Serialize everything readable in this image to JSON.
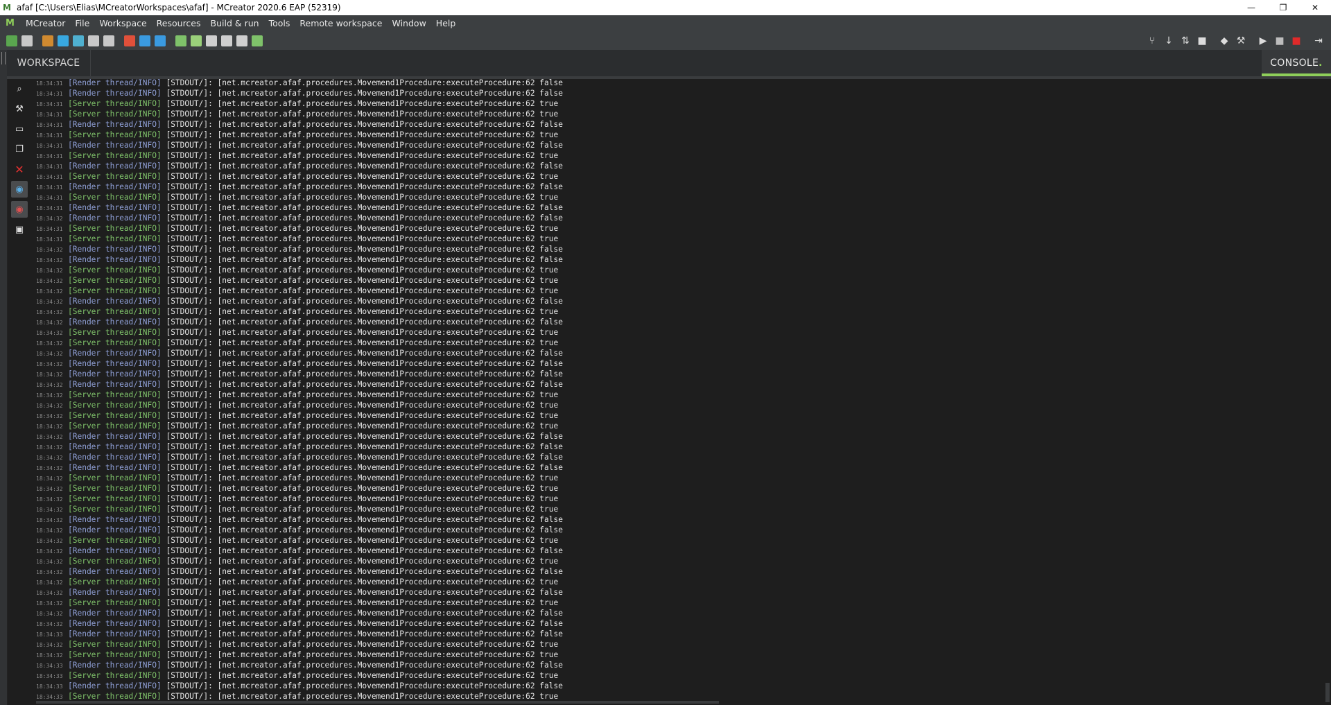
{
  "window": {
    "title": "afaf [C:\\Users\\Elias\\MCreatorWorkspaces\\afaf]  - MCreator 2020.6 EAP (52319)",
    "minimize": "—",
    "maximize": "❐",
    "close": "✕"
  },
  "menubar": {
    "items": [
      "MCreator",
      "File",
      "Workspace",
      "Resources",
      "Build & run",
      "Tools",
      "Remote workspace",
      "Window",
      "Help"
    ]
  },
  "toolbar": {
    "left_icon_colors": [
      "#5aa64f",
      "#c8c8c8",
      "#d08a30",
      "#38a8e0",
      "#4fb0d0",
      "#c8c8c8",
      "#c8c8c8",
      "#e0503a",
      "#3a9ae0",
      "#3a9ae0",
      "#7fc26a",
      "#9ad07a",
      "#cfcfcf",
      "#cfcfcf",
      "#cfcfcf",
      "#7fc26a"
    ],
    "right_icons": [
      "git-branch-icon",
      "pull-icon",
      "push-icon",
      "folder-icon",
      "eraser-icon",
      "hammer-icon",
      "run-icon",
      "stop-gray-icon",
      "stop-red-icon",
      "export-icon"
    ]
  },
  "tabs": {
    "workspace": "WORKSPACE",
    "console": "CONSOLE",
    "console_dot": "."
  },
  "console_tools": [
    {
      "name": "search-icon",
      "glyph": "⌕"
    },
    {
      "name": "build-icon",
      "glyph": "⚒"
    },
    {
      "name": "terminal-icon",
      "glyph": "▭"
    },
    {
      "name": "copy-icon",
      "glyph": "❐"
    },
    {
      "name": "clear-icon",
      "glyph": "✕"
    },
    {
      "name": "eye-blue-icon",
      "glyph": "◉"
    },
    {
      "name": "eye-red-icon",
      "glyph": "◉"
    },
    {
      "name": "lock-icon",
      "glyph": "🔒"
    }
  ],
  "console": {
    "lines": [
      {
        "time": "18:34:31",
        "thread": "[Render thread/INFO]",
        "text": " [STDOUT/]: [net.mcreator.afaf.procedures.Movemend1Procedure:executeProcedure:62 false"
      },
      {
        "time": "18:34:31",
        "thread": "[Render thread/INFO]",
        "text": " [STDOUT/]: [net.mcreator.afaf.procedures.Movemend1Procedure:executeProcedure:62 false"
      },
      {
        "time": "18:34:31",
        "thread": "[Server thread/INFO]",
        "text": " [STDOUT/]: [net.mcreator.afaf.procedures.Movemend1Procedure:executeProcedure:62 true"
      },
      {
        "time": "18:34:31",
        "thread": "[Server thread/INFO]",
        "text": " [STDOUT/]: [net.mcreator.afaf.procedures.Movemend1Procedure:executeProcedure:62 true"
      },
      {
        "time": "18:34:31",
        "thread": "[Render thread/INFO]",
        "text": " [STDOUT/]: [net.mcreator.afaf.procedures.Movemend1Procedure:executeProcedure:62 false"
      },
      {
        "time": "18:34:31",
        "thread": "[Server thread/INFO]",
        "text": " [STDOUT/]: [net.mcreator.afaf.procedures.Movemend1Procedure:executeProcedure:62 true"
      },
      {
        "time": "18:34:31",
        "thread": "[Render thread/INFO]",
        "text": " [STDOUT/]: [net.mcreator.afaf.procedures.Movemend1Procedure:executeProcedure:62 false"
      },
      {
        "time": "18:34:31",
        "thread": "[Server thread/INFO]",
        "text": " [STDOUT/]: [net.mcreator.afaf.procedures.Movemend1Procedure:executeProcedure:62 true"
      },
      {
        "time": "18:34:31",
        "thread": "[Render thread/INFO]",
        "text": " [STDOUT/]: [net.mcreator.afaf.procedures.Movemend1Procedure:executeProcedure:62 false"
      },
      {
        "time": "18:34:31",
        "thread": "[Server thread/INFO]",
        "text": " [STDOUT/]: [net.mcreator.afaf.procedures.Movemend1Procedure:executeProcedure:62 true"
      },
      {
        "time": "18:34:31",
        "thread": "[Render thread/INFO]",
        "text": " [STDOUT/]: [net.mcreator.afaf.procedures.Movemend1Procedure:executeProcedure:62 false"
      },
      {
        "time": "18:34:31",
        "thread": "[Server thread/INFO]",
        "text": " [STDOUT/]: [net.mcreator.afaf.procedures.Movemend1Procedure:executeProcedure:62 true"
      },
      {
        "time": "18:34:31",
        "thread": "[Render thread/INFO]",
        "text": " [STDOUT/]: [net.mcreator.afaf.procedures.Movemend1Procedure:executeProcedure:62 false"
      },
      {
        "time": "18:34:32",
        "thread": "[Render thread/INFO]",
        "text": " [STDOUT/]: [net.mcreator.afaf.procedures.Movemend1Procedure:executeProcedure:62 false"
      },
      {
        "time": "18:34:31",
        "thread": "[Server thread/INFO]",
        "text": " [STDOUT/]: [net.mcreator.afaf.procedures.Movemend1Procedure:executeProcedure:62 true"
      },
      {
        "time": "18:34:31",
        "thread": "[Server thread/INFO]",
        "text": " [STDOUT/]: [net.mcreator.afaf.procedures.Movemend1Procedure:executeProcedure:62 true"
      },
      {
        "time": "18:34:32",
        "thread": "[Render thread/INFO]",
        "text": " [STDOUT/]: [net.mcreator.afaf.procedures.Movemend1Procedure:executeProcedure:62 false"
      },
      {
        "time": "18:34:32",
        "thread": "[Render thread/INFO]",
        "text": " [STDOUT/]: [net.mcreator.afaf.procedures.Movemend1Procedure:executeProcedure:62 false"
      },
      {
        "time": "18:34:32",
        "thread": "[Server thread/INFO]",
        "text": " [STDOUT/]: [net.mcreator.afaf.procedures.Movemend1Procedure:executeProcedure:62 true"
      },
      {
        "time": "18:34:32",
        "thread": "[Server thread/INFO]",
        "text": " [STDOUT/]: [net.mcreator.afaf.procedures.Movemend1Procedure:executeProcedure:62 true"
      },
      {
        "time": "18:34:32",
        "thread": "[Server thread/INFO]",
        "text": " [STDOUT/]: [net.mcreator.afaf.procedures.Movemend1Procedure:executeProcedure:62 true"
      },
      {
        "time": "18:34:32",
        "thread": "[Render thread/INFO]",
        "text": " [STDOUT/]: [net.mcreator.afaf.procedures.Movemend1Procedure:executeProcedure:62 false"
      },
      {
        "time": "18:34:32",
        "thread": "[Server thread/INFO]",
        "text": " [STDOUT/]: [net.mcreator.afaf.procedures.Movemend1Procedure:executeProcedure:62 true"
      },
      {
        "time": "18:34:32",
        "thread": "[Render thread/INFO]",
        "text": " [STDOUT/]: [net.mcreator.afaf.procedures.Movemend1Procedure:executeProcedure:62 false"
      },
      {
        "time": "18:34:32",
        "thread": "[Server thread/INFO]",
        "text": " [STDOUT/]: [net.mcreator.afaf.procedures.Movemend1Procedure:executeProcedure:62 true"
      },
      {
        "time": "18:34:32",
        "thread": "[Server thread/INFO]",
        "text": " [STDOUT/]: [net.mcreator.afaf.procedures.Movemend1Procedure:executeProcedure:62 true"
      },
      {
        "time": "18:34:32",
        "thread": "[Render thread/INFO]",
        "text": " [STDOUT/]: [net.mcreator.afaf.procedures.Movemend1Procedure:executeProcedure:62 false"
      },
      {
        "time": "18:34:32",
        "thread": "[Render thread/INFO]",
        "text": " [STDOUT/]: [net.mcreator.afaf.procedures.Movemend1Procedure:executeProcedure:62 false"
      },
      {
        "time": "18:34:32",
        "thread": "[Render thread/INFO]",
        "text": " [STDOUT/]: [net.mcreator.afaf.procedures.Movemend1Procedure:executeProcedure:62 false"
      },
      {
        "time": "18:34:32",
        "thread": "[Render thread/INFO]",
        "text": " [STDOUT/]: [net.mcreator.afaf.procedures.Movemend1Procedure:executeProcedure:62 false"
      },
      {
        "time": "18:34:32",
        "thread": "[Server thread/INFO]",
        "text": " [STDOUT/]: [net.mcreator.afaf.procedures.Movemend1Procedure:executeProcedure:62 true"
      },
      {
        "time": "18:34:32",
        "thread": "[Server thread/INFO]",
        "text": " [STDOUT/]: [net.mcreator.afaf.procedures.Movemend1Procedure:executeProcedure:62 true"
      },
      {
        "time": "18:34:32",
        "thread": "[Server thread/INFO]",
        "text": " [STDOUT/]: [net.mcreator.afaf.procedures.Movemend1Procedure:executeProcedure:62 true"
      },
      {
        "time": "18:34:32",
        "thread": "[Server thread/INFO]",
        "text": " [STDOUT/]: [net.mcreator.afaf.procedures.Movemend1Procedure:executeProcedure:62 true"
      },
      {
        "time": "18:34:32",
        "thread": "[Render thread/INFO]",
        "text": " [STDOUT/]: [net.mcreator.afaf.procedures.Movemend1Procedure:executeProcedure:62 false"
      },
      {
        "time": "18:34:32",
        "thread": "[Render thread/INFO]",
        "text": " [STDOUT/]: [net.mcreator.afaf.procedures.Movemend1Procedure:executeProcedure:62 false"
      },
      {
        "time": "18:34:32",
        "thread": "[Render thread/INFO]",
        "text": " [STDOUT/]: [net.mcreator.afaf.procedures.Movemend1Procedure:executeProcedure:62 false"
      },
      {
        "time": "18:34:32",
        "thread": "[Render thread/INFO]",
        "text": " [STDOUT/]: [net.mcreator.afaf.procedures.Movemend1Procedure:executeProcedure:62 false"
      },
      {
        "time": "18:34:32",
        "thread": "[Server thread/INFO]",
        "text": " [STDOUT/]: [net.mcreator.afaf.procedures.Movemend1Procedure:executeProcedure:62 true"
      },
      {
        "time": "18:34:32",
        "thread": "[Server thread/INFO]",
        "text": " [STDOUT/]: [net.mcreator.afaf.procedures.Movemend1Procedure:executeProcedure:62 true"
      },
      {
        "time": "18:34:32",
        "thread": "[Server thread/INFO]",
        "text": " [STDOUT/]: [net.mcreator.afaf.procedures.Movemend1Procedure:executeProcedure:62 true"
      },
      {
        "time": "18:34:32",
        "thread": "[Server thread/INFO]",
        "text": " [STDOUT/]: [net.mcreator.afaf.procedures.Movemend1Procedure:executeProcedure:62 true"
      },
      {
        "time": "18:34:32",
        "thread": "[Render thread/INFO]",
        "text": " [STDOUT/]: [net.mcreator.afaf.procedures.Movemend1Procedure:executeProcedure:62 false"
      },
      {
        "time": "18:34:32",
        "thread": "[Render thread/INFO]",
        "text": " [STDOUT/]: [net.mcreator.afaf.procedures.Movemend1Procedure:executeProcedure:62 false"
      },
      {
        "time": "18:34:32",
        "thread": "[Server thread/INFO]",
        "text": " [STDOUT/]: [net.mcreator.afaf.procedures.Movemend1Procedure:executeProcedure:62 true"
      },
      {
        "time": "18:34:32",
        "thread": "[Render thread/INFO]",
        "text": " [STDOUT/]: [net.mcreator.afaf.procedures.Movemend1Procedure:executeProcedure:62 false"
      },
      {
        "time": "18:34:32",
        "thread": "[Server thread/INFO]",
        "text": " [STDOUT/]: [net.mcreator.afaf.procedures.Movemend1Procedure:executeProcedure:62 true"
      },
      {
        "time": "18:34:32",
        "thread": "[Render thread/INFO]",
        "text": " [STDOUT/]: [net.mcreator.afaf.procedures.Movemend1Procedure:executeProcedure:62 false"
      },
      {
        "time": "18:34:32",
        "thread": "[Server thread/INFO]",
        "text": " [STDOUT/]: [net.mcreator.afaf.procedures.Movemend1Procedure:executeProcedure:62 true"
      },
      {
        "time": "18:34:32",
        "thread": "[Render thread/INFO]",
        "text": " [STDOUT/]: [net.mcreator.afaf.procedures.Movemend1Procedure:executeProcedure:62 false"
      },
      {
        "time": "18:34:32",
        "thread": "[Server thread/INFO]",
        "text": " [STDOUT/]: [net.mcreator.afaf.procedures.Movemend1Procedure:executeProcedure:62 true"
      },
      {
        "time": "18:34:32",
        "thread": "[Render thread/INFO]",
        "text": " [STDOUT/]: [net.mcreator.afaf.procedures.Movemend1Procedure:executeProcedure:62 false"
      },
      {
        "time": "18:34:32",
        "thread": "[Render thread/INFO]",
        "text": " [STDOUT/]: [net.mcreator.afaf.procedures.Movemend1Procedure:executeProcedure:62 false"
      },
      {
        "time": "18:34:33",
        "thread": "[Render thread/INFO]",
        "text": " [STDOUT/]: [net.mcreator.afaf.procedures.Movemend1Procedure:executeProcedure:62 false"
      },
      {
        "time": "18:34:32",
        "thread": "[Server thread/INFO]",
        "text": " [STDOUT/]: [net.mcreator.afaf.procedures.Movemend1Procedure:executeProcedure:62 true"
      },
      {
        "time": "18:34:32",
        "thread": "[Server thread/INFO]",
        "text": " [STDOUT/]: [net.mcreator.afaf.procedures.Movemend1Procedure:executeProcedure:62 true"
      },
      {
        "time": "18:34:33",
        "thread": "[Render thread/INFO]",
        "text": " [STDOUT/]: [net.mcreator.afaf.procedures.Movemend1Procedure:executeProcedure:62 false"
      },
      {
        "time": "18:34:33",
        "thread": "[Server thread/INFO]",
        "text": " [STDOUT/]: [net.mcreator.afaf.procedures.Movemend1Procedure:executeProcedure:62 true"
      },
      {
        "time": "18:34:33",
        "thread": "[Render thread/INFO]",
        "text": " [STDOUT/]: [net.mcreator.afaf.procedures.Movemend1Procedure:executeProcedure:62 false"
      },
      {
        "time": "18:34:33",
        "thread": "[Server thread/INFO]",
        "text": " [STDOUT/]: [net.mcreator.afaf.procedures.Movemend1Procedure:executeProcedure:62 true"
      }
    ]
  }
}
